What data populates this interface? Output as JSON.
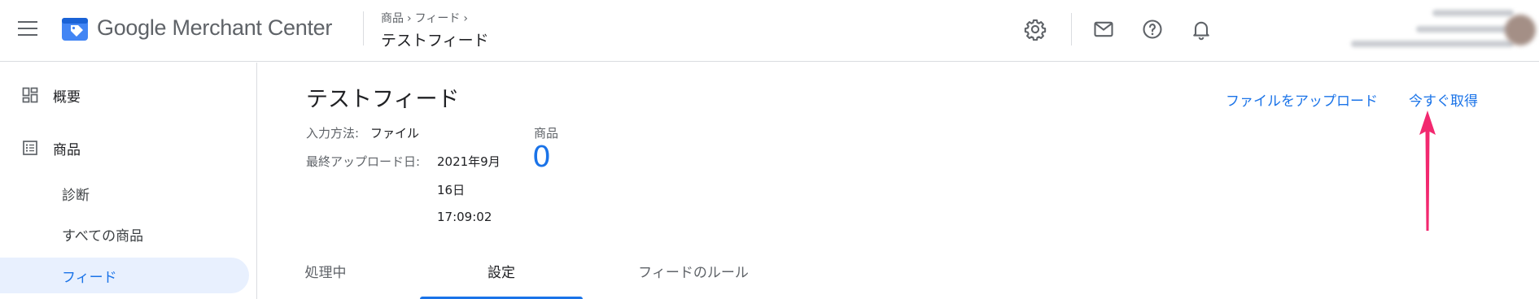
{
  "app": {
    "brand": "Google Merchant Center",
    "breadcrumb": [
      "商品",
      "フィード"
    ],
    "page_title": "テストフィード"
  },
  "header_icons": [
    "settings-gear-icon",
    "mail-icon",
    "help-icon",
    "notifications-bell-icon"
  ],
  "sidebar": {
    "items": [
      {
        "label": "概要",
        "icon": "dashboard-icon"
      },
      {
        "label": "商品",
        "icon": "list-icon"
      },
      {
        "label": "診断"
      },
      {
        "label": "すべての商品"
      },
      {
        "label": "フィード",
        "active": true
      }
    ]
  },
  "feed": {
    "title": "テストフィード",
    "input_method_label": "入力方法:",
    "input_method_value": "ファイル",
    "last_upload_label": "最終アップロード日:",
    "last_upload_value_lines": [
      "2021年9月",
      "16日",
      "17:09:02"
    ],
    "products_label": "商品",
    "products_count": "0"
  },
  "actions": {
    "upload_file": "ファイルをアップロード",
    "fetch_now": "今すぐ取得"
  },
  "tabs": [
    {
      "label": "処理中",
      "active": false
    },
    {
      "label": "設定",
      "active": true
    },
    {
      "label": "フィードのルール",
      "active": false
    }
  ],
  "colors": {
    "accent": "#1a73e8",
    "annotation_arrow": "#f2286f",
    "active_nav_bg": "#e8f0fe"
  }
}
